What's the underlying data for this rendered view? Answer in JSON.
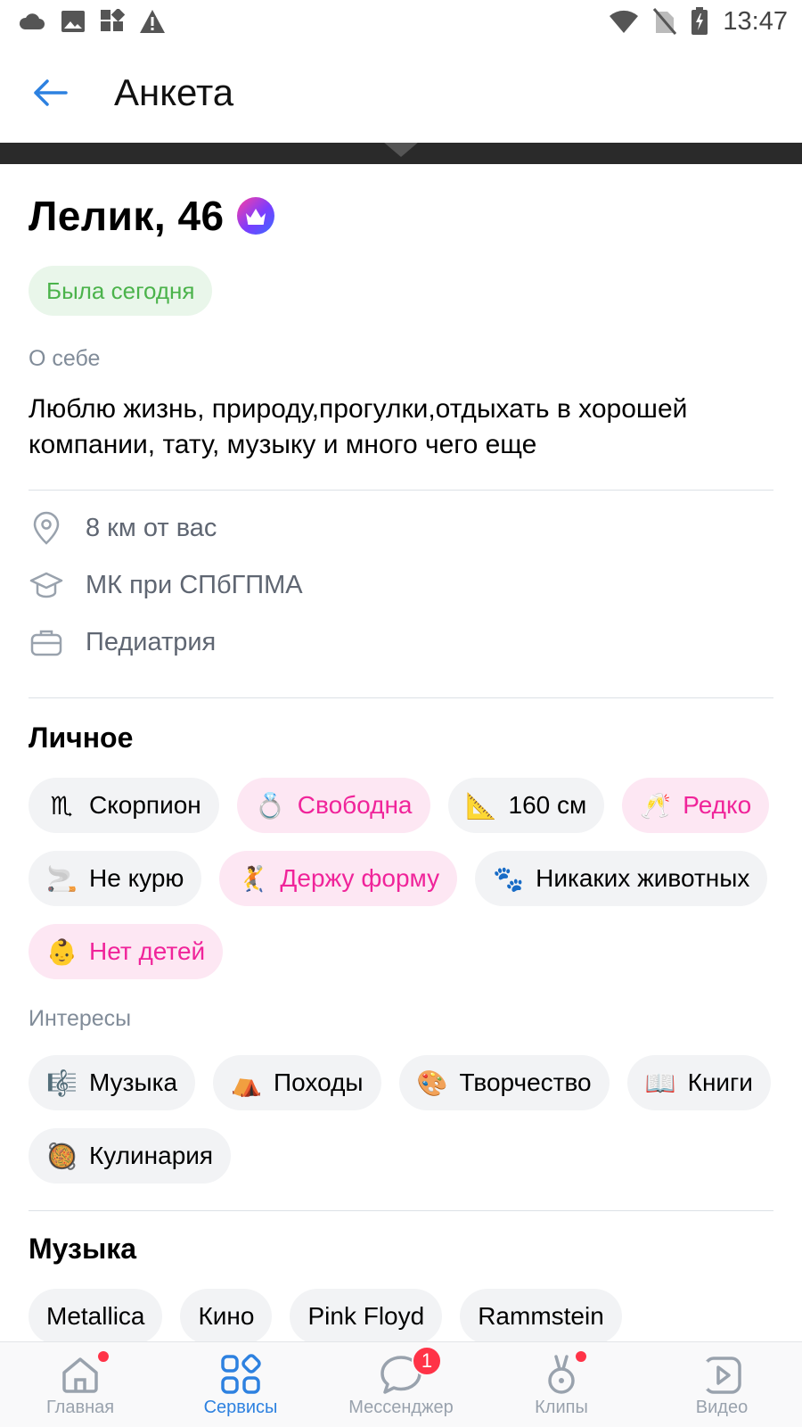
{
  "status_bar": {
    "time": "13:47"
  },
  "header": {
    "title": "Анкета"
  },
  "profile": {
    "name_age": "Лелик, 46",
    "online": "Была сегодня",
    "about_label": "О себе",
    "about": "Люблю жизнь, природу,прогулки,отдыхать в хорошей компании, тату, музыку и много чего еще",
    "distance": "8 км от вас",
    "education": "МК при СПбГПМА",
    "work": "Педиатрия"
  },
  "personal": {
    "title": "Личное",
    "chips": [
      {
        "emoji": "♏",
        "label": "Скорпион"
      },
      {
        "emoji": "💍",
        "label": "Свободна"
      },
      {
        "emoji": "📐",
        "label": "160 см"
      },
      {
        "emoji": "🥂",
        "label": "Редко"
      },
      {
        "emoji": "🚬",
        "label": "Не курю"
      },
      {
        "emoji": "🤾",
        "label": "Держу форму"
      },
      {
        "emoji": "🐾",
        "label": "Никаких животных"
      },
      {
        "emoji": "👶",
        "label": "Нет детей"
      }
    ]
  },
  "interests": {
    "title": "Интересы",
    "chips": [
      {
        "emoji": "🎼",
        "label": "Музыка"
      },
      {
        "emoji": "⛺",
        "label": "Походы"
      },
      {
        "emoji": "🎨",
        "label": "Творчество"
      },
      {
        "emoji": "📖",
        "label": "Книги"
      },
      {
        "emoji": "🥘",
        "label": "Кулинария"
      }
    ]
  },
  "music": {
    "title": "Музыка",
    "chips": [
      "Metallica",
      "Кино",
      "Pink Floyd",
      "Rammstein"
    ]
  },
  "tabbar": {
    "home": "Главная",
    "services": "Сервисы",
    "messenger": "Мессенджер",
    "messenger_badge": "1",
    "clips": "Клипы",
    "video": "Видео"
  },
  "colors": {
    "accent": "#2d81e0",
    "pink": "#f0249a",
    "online": "#4bb34b"
  }
}
